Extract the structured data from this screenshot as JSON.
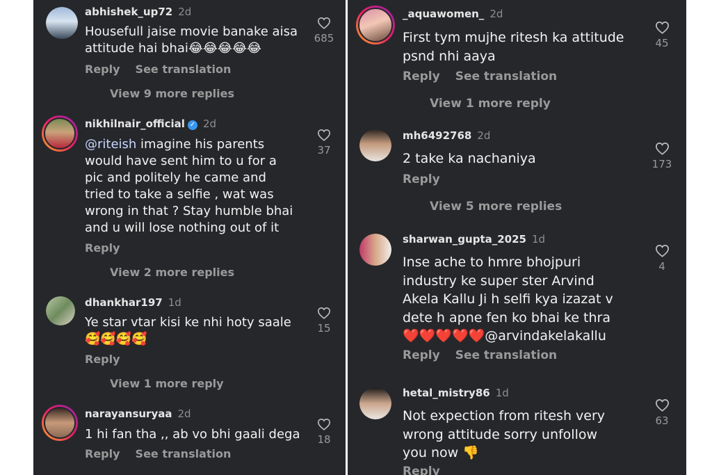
{
  "left": [
    {
      "username": "abhishek_up72",
      "time": "2d",
      "verified": false,
      "lines": [
        "Housefull jaise movie banake aisa",
        "attitude hai bhai😂😂😂😂😂"
      ],
      "reply": "Reply",
      "translate": "See translation",
      "likes": "685",
      "view_more": "View 9 more replies"
    },
    {
      "username": "nikhilnair_official",
      "time": "2d",
      "verified": true,
      "mention": "@riteish",
      "lines": [
        " imagine his parents",
        "would have sent him to u for a",
        "pic and politely he came and",
        "tried to take a selfie , wat was",
        "wrong in that ? Stay humble bhai",
        "and u will lose nothing out of it"
      ],
      "reply": "Reply",
      "likes": "37",
      "view_more": "View 2 more replies"
    },
    {
      "username": "dhankhar197",
      "time": "1d",
      "verified": false,
      "lines": [
        "Ye star vtar kisi ke nhi hoty saale",
        "🥰🥰🥰🥰"
      ],
      "reply": "Reply",
      "likes": "15",
      "view_more": "View 1 more reply"
    },
    {
      "username": "narayansuryaa",
      "time": "2d",
      "verified": false,
      "lines": [
        "1 hi fan tha ,, ab vo bhi gaali dega"
      ],
      "reply": "Reply",
      "translate": "See translation",
      "likes": "18"
    }
  ],
  "right": [
    {
      "username": "_aquawomen_",
      "time": "2d",
      "verified": false,
      "lines": [
        "First tym mujhe ritesh ka attitude",
        "psnd nhi aaya"
      ],
      "reply": "Reply",
      "translate": "See translation",
      "likes": "45",
      "view_more": "View 1 more reply"
    },
    {
      "username": "mh6492768",
      "time": "2d",
      "verified": false,
      "lines": [
        "2 take ka nachaniya"
      ],
      "reply": "Reply",
      "likes": "173",
      "view_more": "View 5 more replies"
    },
    {
      "username": "sharwan_gupta_2025",
      "time": "1d",
      "verified": false,
      "lines": [
        "Inse ache to hmre bhojpuri",
        "industry ke super ster Arvind",
        "Akela Kallu Ji h selfi kya izazat v",
        "dete h apne fen ko bhai ke thra",
        "❤️❤️❤️❤️❤️@arvindakelakallu"
      ],
      "reply": "Reply",
      "translate": "See translation",
      "likes": "4"
    },
    {
      "username": "hetal_mistry86",
      "time": "1d",
      "verified": false,
      "lines": [
        "Not expection from ritesh very",
        "wrong attitude sorry unfollow",
        "you now 👎"
      ],
      "reply": "Reply",
      "likes": "63"
    }
  ],
  "icons": {
    "like": "heart-outline-icon",
    "verified": "verified-badge-icon"
  },
  "colors": {
    "background": "#26272b",
    "text": "#f2f2f2",
    "muted": "#9a9a9a",
    "verified": "#3897f0"
  }
}
